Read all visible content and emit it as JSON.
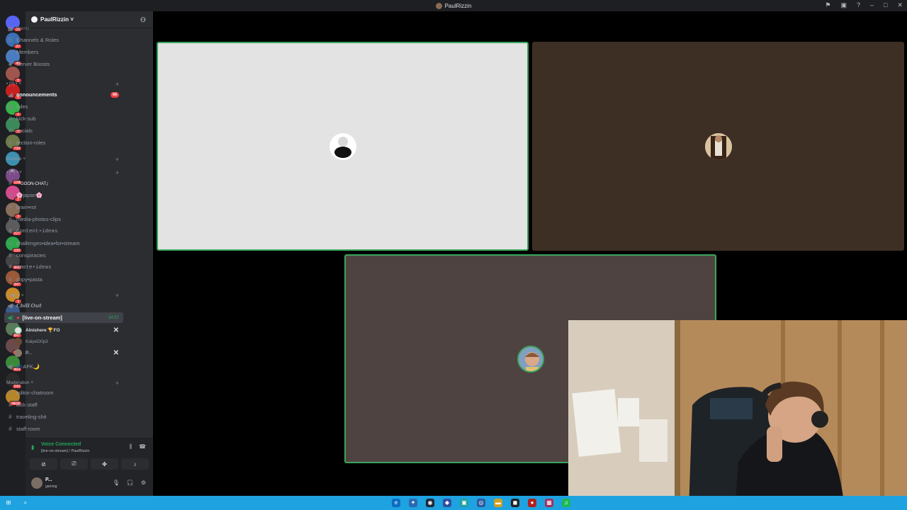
{
  "window": {
    "title": "PaulRizzin"
  },
  "server": {
    "name": "PaulRizzin ˅"
  },
  "guild_badges": [
    "20",
    "37",
    "46",
    "8",
    "1",
    "4",
    "3",
    "739",
    "124",
    "1",
    "3",
    "227",
    "130",
    "441",
    "347",
    "3",
    "8",
    "847",
    "1k+",
    "464",
    "240",
    "NEW"
  ],
  "menu": [
    {
      "label": "Events",
      "icon": "calendar-icon"
    },
    {
      "label": "Channels & Roles",
      "icon": "list-icon"
    },
    {
      "label": "Members",
      "icon": "members-icon"
    },
    {
      "label": "Server Boosts",
      "icon": "boost-icon"
    }
  ],
  "category_1": {
    "label": "• [?] • ˅"
  },
  "channels_1": [
    {
      "label": "announcements",
      "icon": "megaphone-icon",
      "badge": "66"
    },
    {
      "label": "rules",
      "icon": "rules-icon"
    },
    {
      "label": "kick-sub",
      "icon": "hash-icon"
    },
    {
      "label": "socials",
      "icon": "hash-icon"
    },
    {
      "label": "rection-roles",
      "icon": "hash-icon"
    }
  ],
  "category_archive": {
    "label": "Archive ˅"
  },
  "category_2": {
    "label": "• [▀] • ˅"
  },
  "channels_2": [
    {
      "label": "『GOON-CHAT』"
    },
    {
      "label": "🌸japan🌸"
    },
    {
      "label": "brain•rot"
    },
    {
      "label": "media-photos-clips"
    },
    {
      "label": "content•ideas"
    },
    {
      "label": "challenges•idea•for•stream"
    },
    {
      "label": "conspiracies"
    },
    {
      "label": "emote•ideas"
    },
    {
      "label": "copy•pasta"
    }
  ],
  "category_3": {
    "label": "• [◀)] • ˅"
  },
  "voice_channels": {
    "chill_out": "𝘾𝙝𝙞𝙡𝙡 𝙊𝙪𝙩",
    "live": {
      "label": "[live-on-stream]",
      "timer": "34:57"
    },
    "users": [
      {
        "name": "Alnishere 🏆FO"
      },
      {
        "name": "KaiyeD0p3"
      },
      {
        "name": "P..."
      }
    ],
    "afk": "💤AFK🌙"
  },
  "category_mod": {
    "label": "Moderation ˅"
  },
  "channels_mod": [
    {
      "label": "editor-chatroom"
    },
    {
      "label": "kick-staff"
    },
    {
      "label": "traveling-shit"
    },
    {
      "label": "staff-room"
    }
  ],
  "voice_panel": {
    "status": "Voice Connected",
    "sub": "[live-on-stream] / PaulRizzin"
  },
  "user_panel": {
    "name": "P...",
    "status": "gaming"
  },
  "colors": {
    "tile_1": "#e3e3e3",
    "tile_2": "#3e2f24",
    "tile_3": "#4f4341",
    "speaking": "#3ba55d",
    "taskbar": "#1ea2e0"
  }
}
